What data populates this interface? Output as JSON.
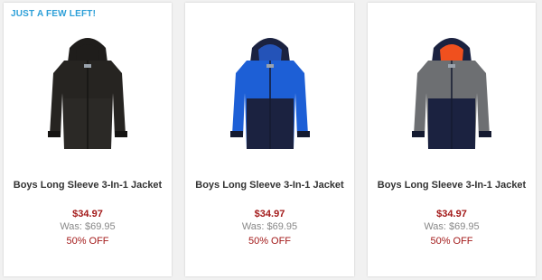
{
  "products": [
    {
      "badge": "JUST A FEW LEFT!",
      "name": "Boys Long Sleeve 3-In-1 Jacket",
      "price": "$34.97",
      "was": "Was: $69.95",
      "discount": "50% OFF",
      "colors": {
        "upper": "#262421",
        "lower": "#2b2926",
        "hood": "#1f1d1b",
        "lining": "#1f1d1b",
        "cuff": "#151412"
      }
    },
    {
      "badge": "",
      "name": "Boys Long Sleeve 3-In-1 Jacket",
      "price": "$34.97",
      "was": "Was: $69.95",
      "discount": "50% OFF",
      "colors": {
        "upper": "#1d5fd6",
        "lower": "#1b2240",
        "hood": "#1b2240",
        "lining": "#2453b8",
        "cuff": "#141a30"
      }
    },
    {
      "badge": "",
      "name": "Boys Long Sleeve 3-In-1 Jacket",
      "price": "$34.97",
      "was": "Was: $69.95",
      "discount": "50% OFF",
      "colors": {
        "upper": "#6d6f72",
        "lower": "#1b2240",
        "hood": "#1b2240",
        "lining": "#f0501e",
        "cuff": "#141a30"
      }
    }
  ]
}
